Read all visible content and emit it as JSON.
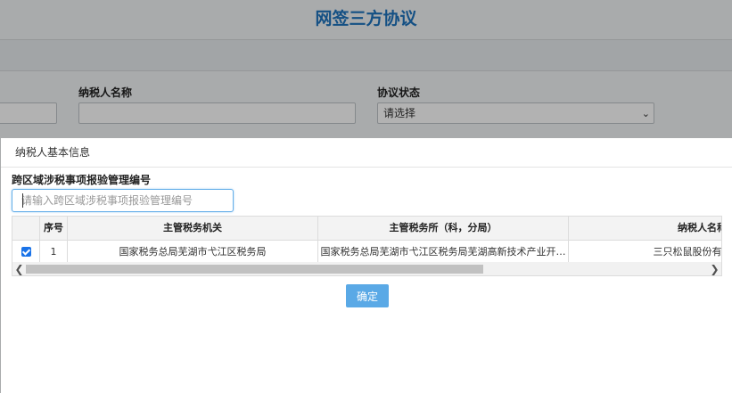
{
  "page": {
    "title": "网签三方协议",
    "filters": {
      "taxpayer_name_label": "纳税人名称",
      "status_label": "协议状态",
      "status_select_value": "请选择"
    }
  },
  "modal": {
    "title": "纳税人基本信息",
    "field_label": "跨区域涉税事项报验管理编号",
    "field_placeholder": "请输入跨区域涉税事项报验管理编号",
    "field_value": "",
    "confirm_label": "确定",
    "table": {
      "columns": [
        "",
        "序号",
        "主管税务机关",
        "主管税务所（科，分局）",
        "纳税人名称"
      ],
      "rows": [
        {
          "checked": true,
          "index": "1",
          "tax_authority": "国家税务总局芜湖市弋江区税务局",
          "tax_office": "国家税务总局芜湖市弋江区税务局芜湖高新技术产业开…",
          "taxpayer_name": "三只松鼠股份有限公司"
        }
      ]
    }
  },
  "colors": {
    "title": "#1e73be",
    "accent": "#5aa9e6",
    "checkbox": "#1a73e8"
  }
}
